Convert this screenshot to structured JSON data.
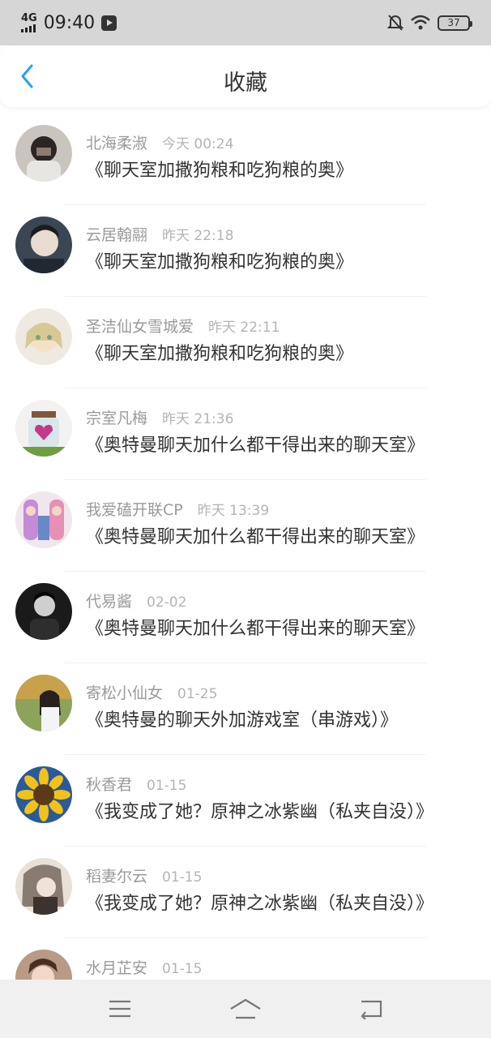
{
  "status_bar": {
    "network": "4G",
    "time": "09:40",
    "battery": "37",
    "icons": [
      "signal-icon",
      "media-icon",
      "mute-bell-icon",
      "wifi-icon",
      "battery-icon"
    ]
  },
  "header": {
    "title": "收藏",
    "back_icon": "chevron-left-icon",
    "accent": "#2aa0e8"
  },
  "favorites": [
    {
      "author": "北海柔淑",
      "time": "今天 00:24",
      "title": "《聊天室加撒狗粮和吃狗粮的奥》"
    },
    {
      "author": "云居翰翮",
      "time": "昨天 22:18",
      "title": "《聊天室加撒狗粮和吃狗粮的奥》"
    },
    {
      "author": "圣洁仙女雪城爱",
      "time": "昨天 22:11",
      "title": "《聊天室加撒狗粮和吃狗粮的奥》"
    },
    {
      "author": "宗室凡梅",
      "time": "昨天 21:36",
      "title": "《奥特曼聊天加什么都干得出来的聊天室》"
    },
    {
      "author": "我爱磕开联CP",
      "time": "昨天 13:39",
      "title": "《奥特曼聊天加什么都干得出来的聊天室》"
    },
    {
      "author": "代易酱",
      "time": "02-02",
      "title": "《奥特曼聊天加什么都干得出来的聊天室》"
    },
    {
      "author": "寄松小仙女",
      "time": "01-25",
      "title": "《奥特曼的聊天外加游戏室（串游戏）》"
    },
    {
      "author": "秋香君",
      "time": "01-15",
      "title": "《我变成了她？原神之冰紫幽（私夹自没）》"
    },
    {
      "author": "稻妻尔云",
      "time": "01-15",
      "title": "《我变成了她？原神之冰紫幽（私夹自没）》"
    },
    {
      "author": "水月芷安",
      "time": "01-15",
      "title": ""
    }
  ],
  "nav_bar": {
    "icons": [
      "menu-icon",
      "home-icon",
      "back-icon"
    ]
  }
}
